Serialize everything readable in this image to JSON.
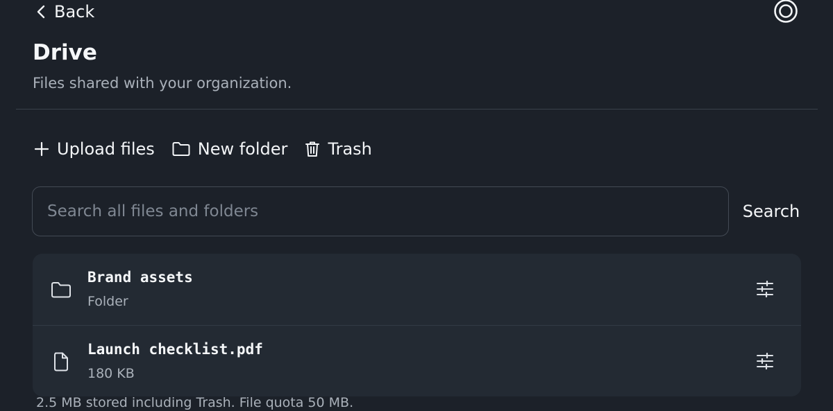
{
  "nav": {
    "back_label": "Back",
    "back_icon": "chevron-left-icon",
    "account_icon": "account-circle-icon"
  },
  "header": {
    "title": "Drive",
    "subtitle": "Files shared with your organization."
  },
  "toolbar": {
    "upload_label": "Upload files",
    "upload_icon": "plus-icon",
    "new_folder_label": "New folder",
    "new_folder_icon": "folder-icon",
    "trash_label": "Trash",
    "trash_icon": "trash-icon"
  },
  "search": {
    "placeholder": "Search all files and folders",
    "value": "",
    "button_label": "Search"
  },
  "files": [
    {
      "name": "Brand assets",
      "meta": "Folder",
      "icon": "folder-icon",
      "action_icon": "sliders-icon"
    },
    {
      "name": "Launch checklist.pdf",
      "meta": "180 KB",
      "icon": "file-icon",
      "action_icon": "sliders-icon"
    }
  ],
  "footer": {
    "storage_text": "2.5 MB stored including Trash. File quota 50 MB."
  },
  "colors": {
    "background": "#1c2129",
    "panel": "#232a33",
    "text": "#f1f3f6",
    "muted": "#aab1ba",
    "border": "#434a54"
  }
}
